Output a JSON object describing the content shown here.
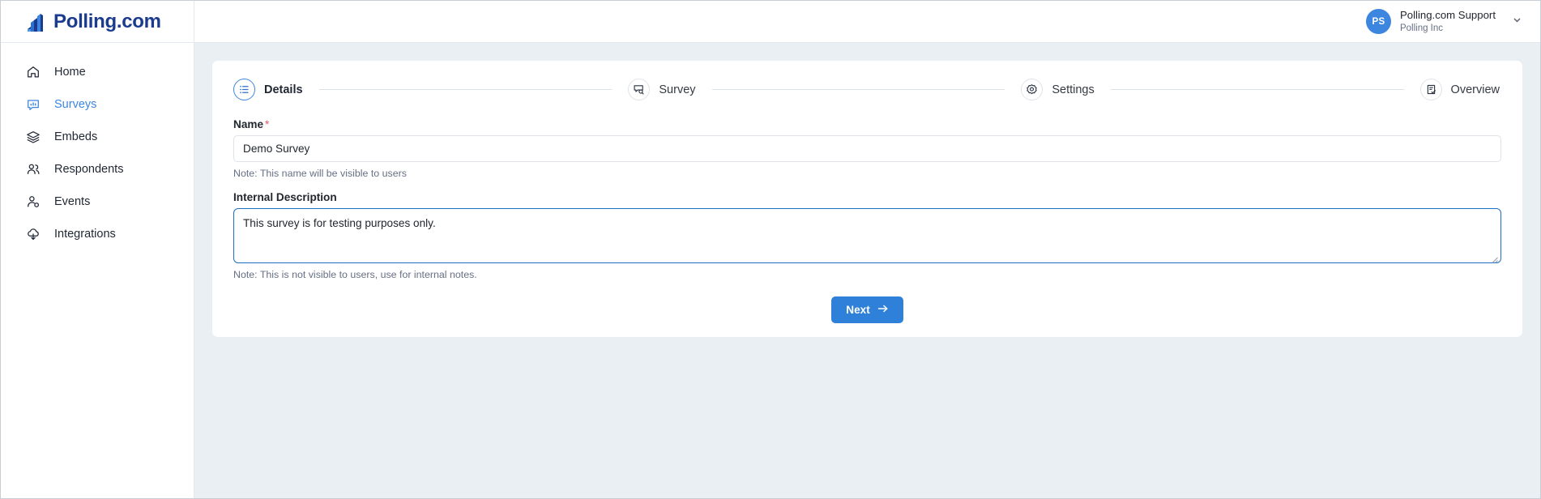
{
  "brand": {
    "name": "Polling.com",
    "logo_icon": "bar-chart-logo-icon",
    "accent_color": "#3c86e0",
    "logo_color": "#1b3b8f"
  },
  "header": {
    "user": {
      "initials": "PS",
      "name": "Polling.com Support",
      "org": "Polling Inc",
      "avatar_color": "#3c86e0",
      "chevron_icon": "chevron-down-icon"
    }
  },
  "sidebar": {
    "items": [
      {
        "label": "Home",
        "icon": "home-icon",
        "active": false
      },
      {
        "label": "Surveys",
        "icon": "survey-chart-icon",
        "active": true
      },
      {
        "label": "Embeds",
        "icon": "layers-icon",
        "active": false
      },
      {
        "label": "Respondents",
        "icon": "people-icon",
        "active": false
      },
      {
        "label": "Events",
        "icon": "person-gear-icon",
        "active": false
      },
      {
        "label": "Integrations",
        "icon": "cloud-upload-icon",
        "active": false
      }
    ]
  },
  "wizard": {
    "steps": [
      {
        "label": "Details",
        "icon": "list-icon",
        "active": true
      },
      {
        "label": "Survey",
        "icon": "message-search-icon",
        "active": false
      },
      {
        "label": "Settings",
        "icon": "gear-icon",
        "active": false
      },
      {
        "label": "Overview",
        "icon": "clipboard-check-icon",
        "active": false
      }
    ]
  },
  "form": {
    "name": {
      "label": "Name",
      "required_marker": "*",
      "value": "Demo Survey",
      "placeholder": "Name",
      "note": "Note: This name will be visible to users"
    },
    "description": {
      "label": "Internal Description",
      "value": "This survey is for testing purposes only.",
      "placeholder": "Internal Description",
      "note": "Note: This is not visible to users, use for internal notes.",
      "focused": true
    },
    "next_button": {
      "label": "Next",
      "icon": "arrow-right-icon",
      "color": "#2f80d8"
    }
  }
}
